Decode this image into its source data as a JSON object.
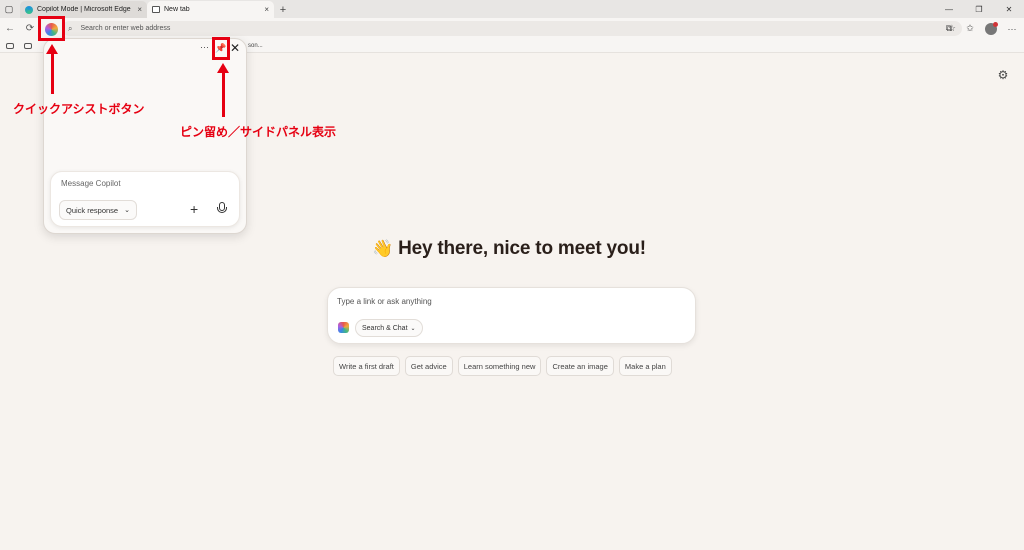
{
  "tabs": [
    {
      "title": "Copilot Mode | Microsoft Edge",
      "icon": "edge-icon"
    },
    {
      "title": "New tab",
      "icon": "page-icon"
    }
  ],
  "toolbar": {
    "tab_actions_icon": "tab-actions-icon",
    "new_tab_label": "+",
    "close_label": "×",
    "minimize_label": "—",
    "restore_label": "❐",
    "window_close_label": "✕"
  },
  "nav": {
    "back_label": "←",
    "refresh_label": "⟳"
  },
  "address_bar": {
    "placeholder": "Search or enter web address"
  },
  "favorites_bar": {
    "truncated_item": "son..."
  },
  "copilot_popup": {
    "more_label": "···",
    "close_label": "✕",
    "message_placeholder": "Message Copilot",
    "response_mode": "Quick response",
    "plus_label": "+"
  },
  "annotations": {
    "quick_assist_button": "クイックアシストボタン",
    "pin_sidepanel": "ピン留め／サイドパネル表示"
  },
  "main": {
    "greeting": "Hey there, nice to meet you!",
    "greeting_emoji": "👋",
    "search_placeholder": "Type a link or ask anything",
    "search_mode": "Search & Chat",
    "suggestions": [
      "Write a first draft",
      "Get advice",
      "Learn something new",
      "Create an image",
      "Make a plan"
    ]
  },
  "colors": {
    "annotation_red": "#e60012",
    "page_bg": "#f7f3ef"
  }
}
